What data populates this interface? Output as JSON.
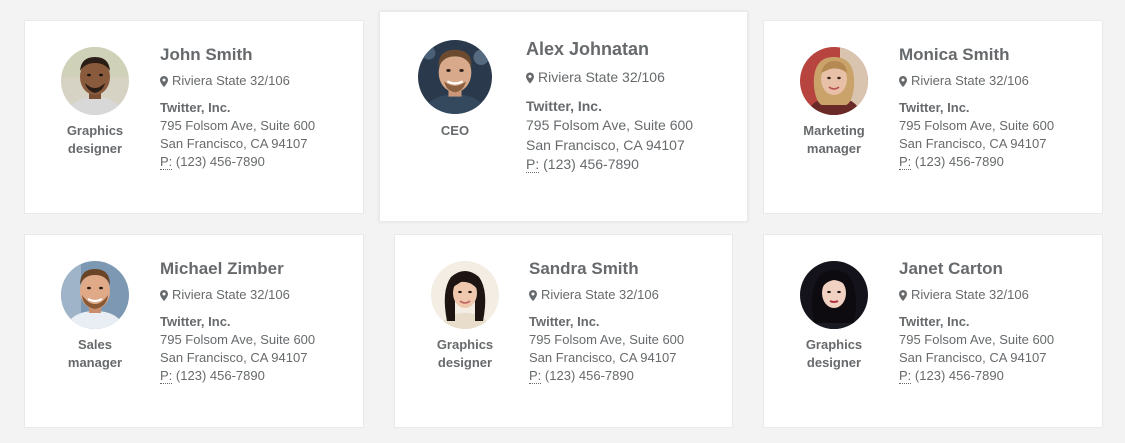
{
  "contacts": [
    {
      "name": "John Smith",
      "role_line1": "Graphics",
      "role_line2": "designer",
      "location": "Riviera State 32/106",
      "company": "Twitter, Inc.",
      "address": "795 Folsom Ave, Suite 600",
      "city": "San Francisco, CA 94107",
      "phone_abbr": "P:",
      "phone": "(123) 456-7890",
      "avatar": "man-short-hair-photo",
      "avatar_colors": {
        "bg": "#d6d2c4",
        "skin": "#8a5a3c",
        "hair": "#2a1e16",
        "shirt": "#d8d8d8"
      }
    },
    {
      "name": "Alex Johnatan",
      "role_line1": "CEO",
      "role_line2": "",
      "location": "Riviera State 32/106",
      "company": "Twitter, Inc.",
      "address": "795 Folsom Ave, Suite 600",
      "city": "San Francisco, CA 94107",
      "phone_abbr": "P:",
      "phone": "(123) 456-7890",
      "avatar": "man-smiling-photo",
      "avatar_colors": {
        "bg": "#2a3a4c",
        "skin": "#d9a98b",
        "hair": "#6b4a30",
        "shirt": "#34495e"
      }
    },
    {
      "name": "Monica Smith",
      "role_line1": "Marketing",
      "role_line2": "manager",
      "location": "Riviera State 32/106",
      "company": "Twitter, Inc.",
      "address": "795 Folsom Ave, Suite 600",
      "city": "San Francisco, CA 94107",
      "phone_abbr": "P:",
      "phone": "(123) 456-7890",
      "avatar": "woman-blonde-photo",
      "avatar_colors": {
        "bg": "#b8443f",
        "skin": "#e8c0a8",
        "hair": "#c9a36a",
        "shirt": "#6a2a28"
      }
    },
    {
      "name": "Michael Zimber",
      "role_line1": "Sales",
      "role_line2": "manager",
      "location": "Riviera State 32/106",
      "company": "Twitter, Inc.",
      "address": "795 Folsom Ave, Suite 600",
      "city": "San Francisco, CA 94107",
      "phone_abbr": "P:",
      "phone": "(123) 456-7890",
      "avatar": "man-beard-photo",
      "avatar_colors": {
        "bg": "#7d98b3",
        "skin": "#e0aa88",
        "hair": "#6a4426",
        "shirt": "#e8eef3"
      }
    },
    {
      "name": "Sandra Smith",
      "role_line1": "Graphics",
      "role_line2": "designer",
      "location": "Riviera State 32/106",
      "company": "Twitter, Inc.",
      "address": "795 Folsom Ave, Suite 600",
      "city": "San Francisco, CA 94107",
      "phone_abbr": "P:",
      "phone": "(123) 456-7890",
      "avatar": "woman-dark-hair-photo",
      "avatar_colors": {
        "bg": "#f3ede4",
        "skin": "#efc8ad",
        "hair": "#1e1512",
        "shirt": "#e8dccb"
      }
    },
    {
      "name": "Janet Carton",
      "role_line1": "Graphics",
      "role_line2": "designer",
      "location": "Riviera State 32/106",
      "company": "Twitter, Inc.",
      "address": "795 Folsom Ave, Suite 600",
      "city": "San Francisco, CA 94107",
      "phone_abbr": "P:",
      "phone": "(123) 456-7890",
      "avatar": "woman-black-hair-photo",
      "avatar_colors": {
        "bg": "#14121a",
        "skin": "#f1d2c2",
        "hair": "#0d0b10",
        "shirt": "#1a1a22"
      }
    }
  ]
}
